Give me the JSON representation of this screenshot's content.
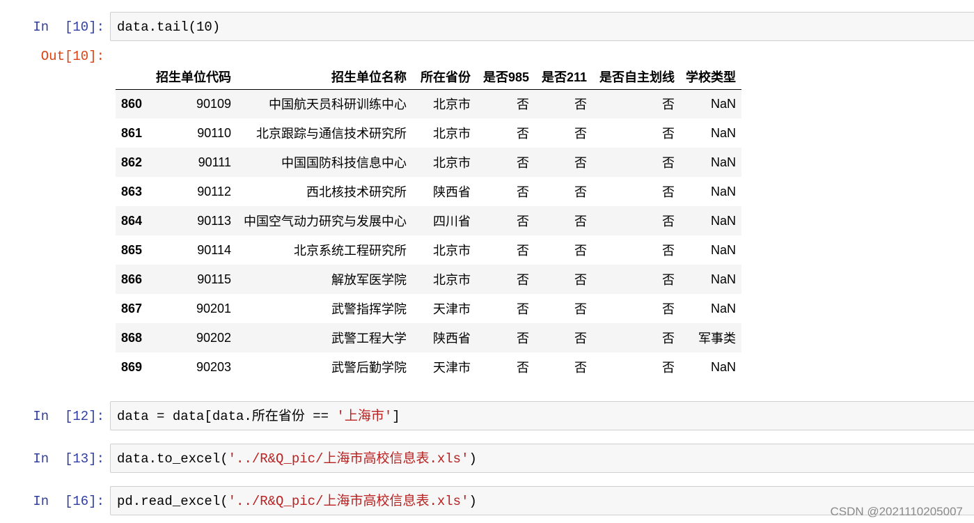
{
  "cells": [
    {
      "prompt": "In  [10]:",
      "code": "data.tail(10)"
    },
    {
      "prompt": "In  [12]:",
      "code_prefix": "data = data[data.所在省份 == ",
      "code_string": "'上海市'",
      "code_suffix": "]"
    },
    {
      "prompt": "In  [13]:",
      "code_prefix": "data.to_excel(",
      "code_string": "'../R&Q_pic/上海市高校信息表.xls'",
      "code_suffix": ")"
    },
    {
      "prompt": "In  [16]:",
      "code_prefix": "pd.read_excel(",
      "code_string": "'../R&Q_pic/上海市高校信息表.xls'",
      "code_suffix": ")"
    }
  ],
  "output_prompt": "Out[10]:",
  "table": {
    "columns": [
      "招生单位代码",
      "招生单位名称",
      "所在省份",
      "是否985",
      "是否211",
      "是否自主划线",
      "学校类型"
    ],
    "rows": [
      {
        "index": "860",
        "cells": [
          "90109",
          "中国航天员科研训练中心",
          "北京市",
          "否",
          "否",
          "否",
          "NaN"
        ]
      },
      {
        "index": "861",
        "cells": [
          "90110",
          "北京跟踪与通信技术研究所",
          "北京市",
          "否",
          "否",
          "否",
          "NaN"
        ]
      },
      {
        "index": "862",
        "cells": [
          "90111",
          "中国国防科技信息中心",
          "北京市",
          "否",
          "否",
          "否",
          "NaN"
        ]
      },
      {
        "index": "863",
        "cells": [
          "90112",
          "西北核技术研究所",
          "陕西省",
          "否",
          "否",
          "否",
          "NaN"
        ]
      },
      {
        "index": "864",
        "cells": [
          "90113",
          "中国空气动力研究与发展中心",
          "四川省",
          "否",
          "否",
          "否",
          "NaN"
        ]
      },
      {
        "index": "865",
        "cells": [
          "90114",
          "北京系统工程研究所",
          "北京市",
          "否",
          "否",
          "否",
          "NaN"
        ]
      },
      {
        "index": "866",
        "cells": [
          "90115",
          "解放军医学院",
          "北京市",
          "否",
          "否",
          "否",
          "NaN"
        ]
      },
      {
        "index": "867",
        "cells": [
          "90201",
          "武警指挥学院",
          "天津市",
          "否",
          "否",
          "否",
          "NaN"
        ]
      },
      {
        "index": "868",
        "cells": [
          "90202",
          "武警工程大学",
          "陕西省",
          "否",
          "否",
          "否",
          "军事类"
        ]
      },
      {
        "index": "869",
        "cells": [
          "90203",
          "武警后勤学院",
          "天津市",
          "否",
          "否",
          "否",
          "NaN"
        ]
      }
    ]
  },
  "watermark": "CSDN @2021110205007",
  "colors": {
    "prompt_in": "#303f9f",
    "prompt_out": "#d84315",
    "string": "#ba2121"
  }
}
